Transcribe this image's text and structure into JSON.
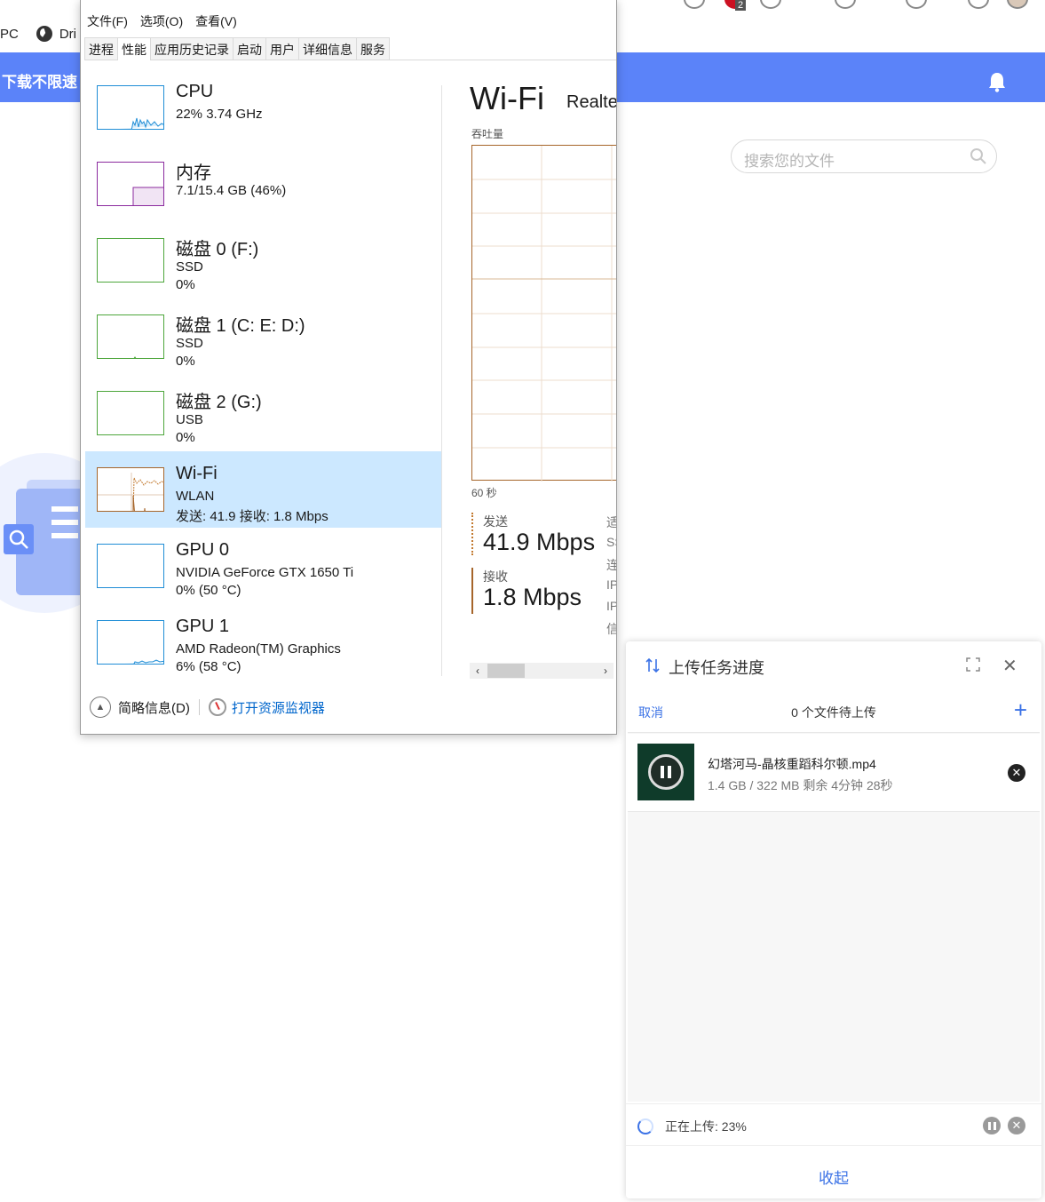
{
  "browser": {
    "bookmarks": [
      {
        "label": "PC",
        "icon": "windows-pc-icon"
      },
      {
        "label": "Dri",
        "icon": "globe-icon"
      }
    ],
    "banner_text": "下载不限速",
    "banner_color": "#5b83f9",
    "notification_badge": "2",
    "search_placeholder": "搜索您的文件"
  },
  "task_manager": {
    "menu": [
      "文件(F)",
      "选项(O)",
      "查看(V)"
    ],
    "tabs": [
      "进程",
      "性能",
      "应用历史记录",
      "启动",
      "用户",
      "详细信息",
      "服务"
    ],
    "active_tab": "性能",
    "resources": [
      {
        "title": "CPU",
        "sub1": "22% 3.74 GHz",
        "sub2": "",
        "color": "#1f8dd6"
      },
      {
        "title": "内存",
        "sub1": "7.1/15.4 GB (46%)",
        "sub2": "",
        "color": "#8b2a9e"
      },
      {
        "title": "磁盘 0 (F:)",
        "sub1": "SSD",
        "sub2": "0%",
        "color": "#4da63b"
      },
      {
        "title": "磁盘 1 (C: E: D:)",
        "sub1": "SSD",
        "sub2": "0%",
        "color": "#4da63b"
      },
      {
        "title": "磁盘 2 (G:)",
        "sub1": "USB",
        "sub2": "0%",
        "color": "#4da63b"
      },
      {
        "title": "Wi-Fi",
        "sub1": "WLAN",
        "sub2": "发送: 41.9 接收: 1.8 Mbps",
        "color": "#a6652a"
      },
      {
        "title": "GPU 0",
        "sub1": "NVIDIA GeForce GTX 1650 Ti",
        "sub2": "0% (50 °C)",
        "color": "#1f8dd6"
      },
      {
        "title": "GPU 1",
        "sub1": "AMD Radeon(TM) Graphics",
        "sub2": "6% (58 °C)",
        "color": "#1f8dd6"
      }
    ],
    "selected_resource": "Wi-Fi",
    "detail": {
      "title": "Wi-Fi",
      "adapter": "Realte",
      "throughput_label": "吞吐量",
      "time_label": "60 秒",
      "send_label": "发送",
      "send_value": "41.9 Mbps",
      "recv_label": "接收",
      "recv_value": "1.8 Mbps",
      "cut_labels": [
        "适",
        "SS",
        "连",
        "IP",
        "IP",
        "信"
      ]
    },
    "footer": {
      "summary_label": "简略信息(D)",
      "monitor_link": "打开资源监视器"
    }
  },
  "upload_panel": {
    "title": "上传任务进度",
    "cancel_label": "取消",
    "pending_label": "0 个文件待上传",
    "file": {
      "name": "幻塔河马-晶核重蹈科尔顿.mp4",
      "meta": "1.4 GB / 322 MB 剩余 4分钟 28秒"
    },
    "status_text": "正在上传: 23%",
    "collapse_label": "收起",
    "accent_color": "#3b72e6"
  }
}
